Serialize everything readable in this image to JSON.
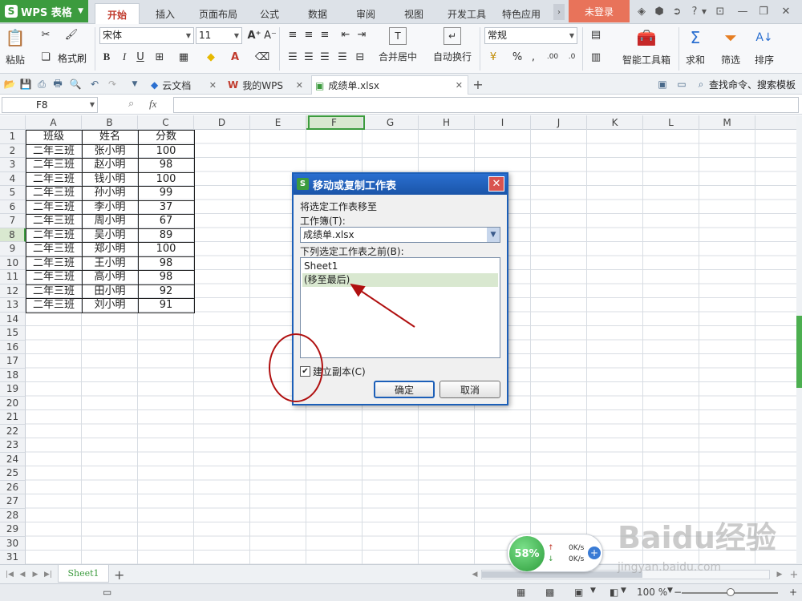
{
  "app": {
    "name": "WPS 表格",
    "logo": "S"
  },
  "ribbon_tabs": [
    "开始",
    "插入",
    "页面布局",
    "公式",
    "数据",
    "审阅",
    "视图",
    "开发工具",
    "特色应用"
  ],
  "login_label": "未登录",
  "ribbon": {
    "paste": "粘贴",
    "format_painter": "格式刷",
    "font_name": "宋体",
    "font_size": "11",
    "merge_center": "合并居中",
    "wrap_text": "自动换行",
    "number_format": "常规",
    "smart_toolbox": "智能工具箱",
    "sum": "求和",
    "filter": "筛选",
    "sort": "排序"
  },
  "doc_tabs": [
    {
      "label": "云文档"
    },
    {
      "label": "我的WPS"
    },
    {
      "label": "成绩单.xlsx"
    }
  ],
  "search_placeholder": "查找命令、搜索模板",
  "formula_bar": {
    "cell_ref": "F8",
    "fx": "fx",
    "content": ""
  },
  "columns": [
    "A",
    "B",
    "C",
    "D",
    "E",
    "F",
    "G",
    "H",
    "I",
    "J",
    "K",
    "L",
    "M"
  ],
  "rows": [
    "1",
    "2",
    "3",
    "4",
    "5",
    "6",
    "7",
    "8",
    "9",
    "10",
    "11",
    "12",
    "13",
    "14",
    "15",
    "16",
    "17",
    "18",
    "19",
    "20",
    "21",
    "22",
    "23",
    "24",
    "25",
    "26",
    "27",
    "28",
    "29",
    "30",
    "31"
  ],
  "table": {
    "headers": [
      "班级",
      "姓名",
      "分数"
    ],
    "rows": [
      [
        "二年三班",
        "张小明",
        "100"
      ],
      [
        "二年三班",
        "赵小明",
        "98"
      ],
      [
        "二年三班",
        "钱小明",
        "100"
      ],
      [
        "二年三班",
        "孙小明",
        "99"
      ],
      [
        "二年三班",
        "李小明",
        "37"
      ],
      [
        "二年三班",
        "周小明",
        "67"
      ],
      [
        "二年三班",
        "吴小明",
        "89"
      ],
      [
        "二年三班",
        "郑小明",
        "100"
      ],
      [
        "二年三班",
        "王小明",
        "98"
      ],
      [
        "二年三班",
        "高小明",
        "98"
      ],
      [
        "二年三班",
        "田小明",
        "92"
      ],
      [
        "二年三班",
        "刘小明",
        "91"
      ]
    ]
  },
  "dialog": {
    "title": "移动或复制工作表",
    "move_label": "将选定工作表移至",
    "workbook_label": "工作簿(T):",
    "workbook_value": "成绩单.xlsx",
    "before_label": "下列选定工作表之前(B):",
    "sheet_options": [
      "Sheet1",
      "(移至最后)"
    ],
    "selected_option": "(移至最后)",
    "copy_label": "建立副本(C)",
    "copy_checked": true,
    "ok": "确定",
    "cancel": "取消"
  },
  "sheet_tabs": [
    "Sheet1"
  ],
  "net_widget": {
    "percent": "58%",
    "up": "0K/s",
    "down": "0K/s"
  },
  "zoom": "100 %",
  "watermark": {
    "brand": "Baidu经验",
    "url": "jingyan.baidu.com"
  },
  "colors": {
    "accent": "#3c9b3e",
    "dialog_title": "#1c5fb8",
    "annotation": "#b01010"
  }
}
